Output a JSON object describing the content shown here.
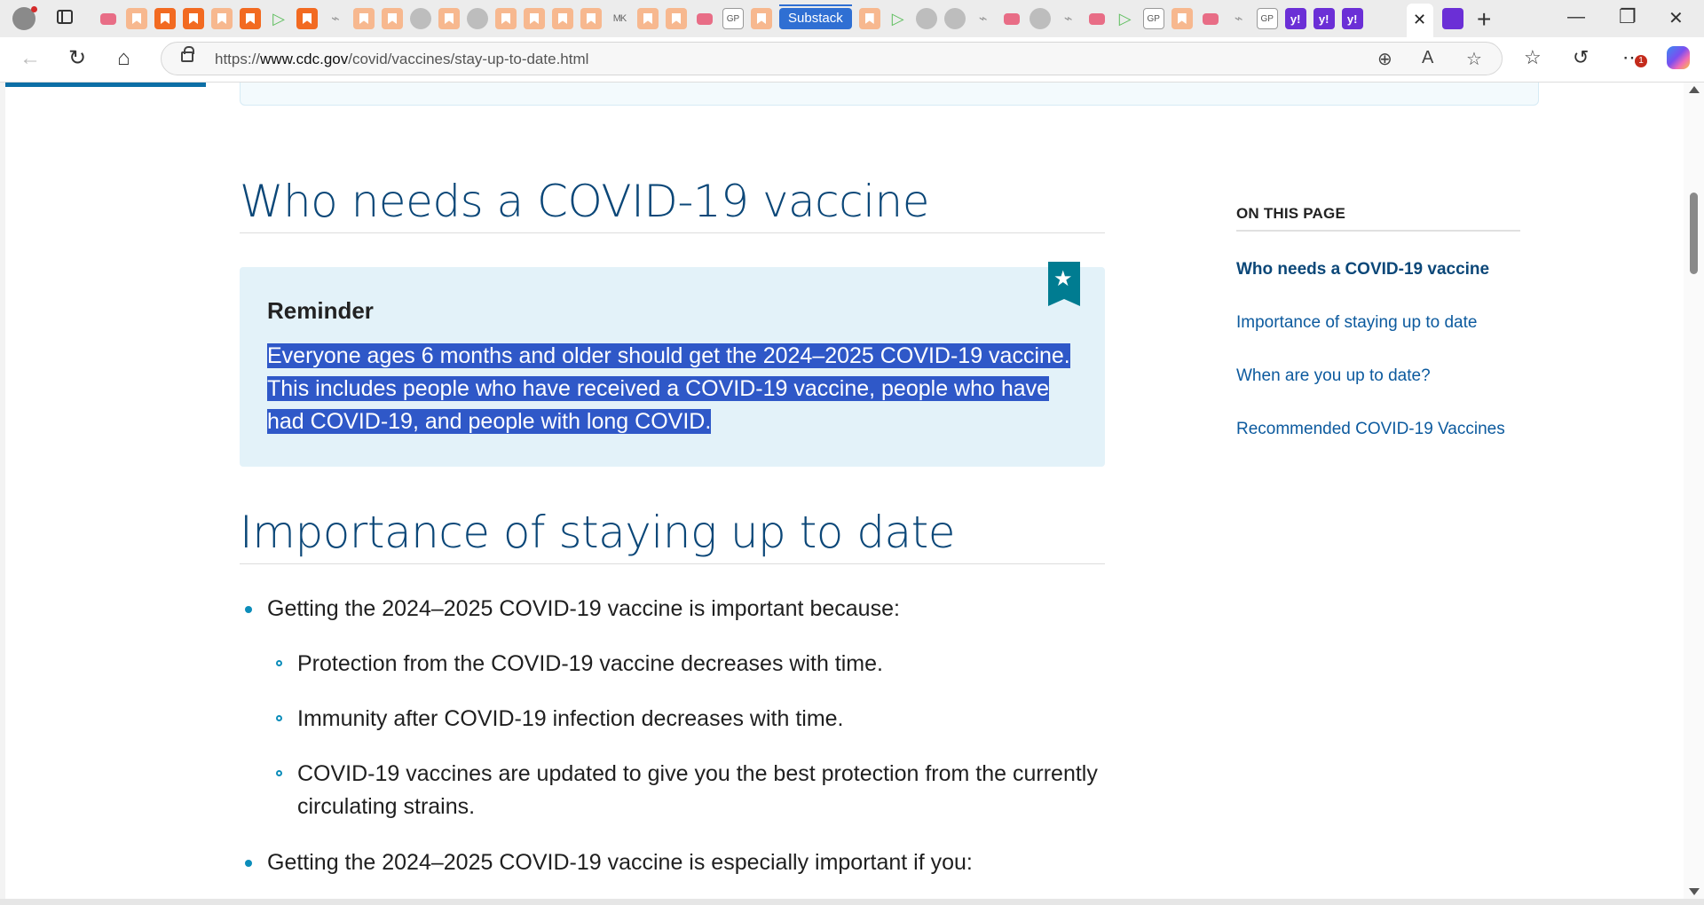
{
  "browser": {
    "substack_tab_label": "Substack",
    "url_prefix": "https://",
    "url_host": "www.cdc.gov",
    "url_path": "/covid/vaccines/stay-up-to-date.html",
    "notification_count": "1",
    "tab_icons": [
      "youtube",
      "bookmark",
      "bookmark-strong",
      "bookmark-strong",
      "bookmark",
      "bookmark-strong",
      "play",
      "bookmark-strong",
      "leaf",
      "bookmark",
      "bookmark",
      "image",
      "bookmark",
      "lock",
      "bookmark",
      "bookmark",
      "bookmark",
      "bookmark",
      "bookmark",
      "mk",
      "bookmark",
      "bookmark",
      "youtube",
      "gp",
      "bookmark"
    ],
    "tab_icons_after": [
      "bookmark",
      "play",
      "search",
      "gray",
      "leaf",
      "youtube",
      "gray",
      "leaf",
      "youtube",
      "play",
      "gp",
      "bookmark",
      "youtube",
      "leaf",
      "gp",
      "yahoo",
      "yahoo",
      "yahoo",
      "mail"
    ],
    "gp_label": "GP",
    "mk_label": "MK",
    "yahoo_label": "y!"
  },
  "content": {
    "section1_title": "Who needs a COVID-19 vaccine",
    "reminder_title": "Reminder",
    "reminder_line1": "Everyone ages 6 months and older should get the 2024–2025 COVID-19 vaccine.",
    "reminder_line2": "This includes people who have received a COVID-19 vaccine, people who have",
    "reminder_line3": "had COVID-19, and people with long COVID.",
    "section2_title": "Importance of staying up to date",
    "bullet1": "Getting the 2024–2025 COVID-19 vaccine is important because:",
    "sub1": "Protection from the COVID-19 vaccine decreases with time.",
    "sub2": "Immunity after COVID-19 infection decreases with time.",
    "sub3_line1": "COVID-19 vaccines are updated to give you the best protection from the currently",
    "sub3_line2": "circulating strains.",
    "bullet2": "Getting the 2024–2025 COVID-19 vaccine is especially important if you:"
  },
  "toc": {
    "heading": "ON THIS PAGE",
    "links": [
      "Who needs a COVID-19 vaccine",
      "Importance of staying up to date",
      "When are you up to date?",
      "Recommended COVID-19 Vaccines"
    ],
    "active_index": 0
  },
  "colors": {
    "heading": "#0b4778",
    "link": "#0c5a9e",
    "callout_bg": "#e3f2f9",
    "selection": "#2f58c8",
    "ribbon": "#007c91",
    "progress": "#0c6fa6"
  }
}
